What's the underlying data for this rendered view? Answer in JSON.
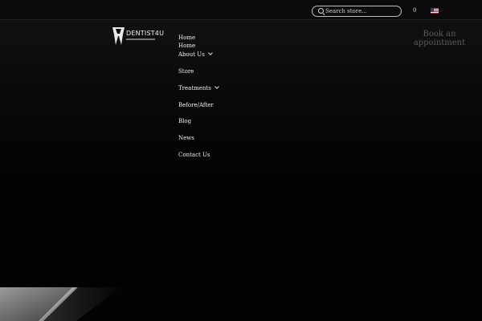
{
  "topbar": {
    "search": {
      "placeholder": "Search store..."
    },
    "cart": {
      "count": "0"
    },
    "language": {
      "flag": "us-flag-icon"
    }
  },
  "logo": {
    "text": "DENTIST4U"
  },
  "nav": {
    "items": [
      {
        "label": "Home",
        "has_dropdown": false
      },
      {
        "label": "Home",
        "has_dropdown": false
      },
      {
        "label": "About Us",
        "has_dropdown": true
      },
      {
        "label": "Store",
        "has_dropdown": false
      },
      {
        "label": "Treatments",
        "has_dropdown": true
      },
      {
        "label": "Before/After",
        "has_dropdown": false
      },
      {
        "label": "Blog",
        "has_dropdown": false
      },
      {
        "label": "News",
        "has_dropdown": false
      },
      {
        "label": "Contact Us",
        "has_dropdown": false
      }
    ]
  },
  "cta": {
    "book_line1": "Book an",
    "book_line2": "appointment"
  },
  "colors": {
    "background": "#020202",
    "text": "#e8e8e8",
    "muted_cta": "#5a5a5a"
  }
}
